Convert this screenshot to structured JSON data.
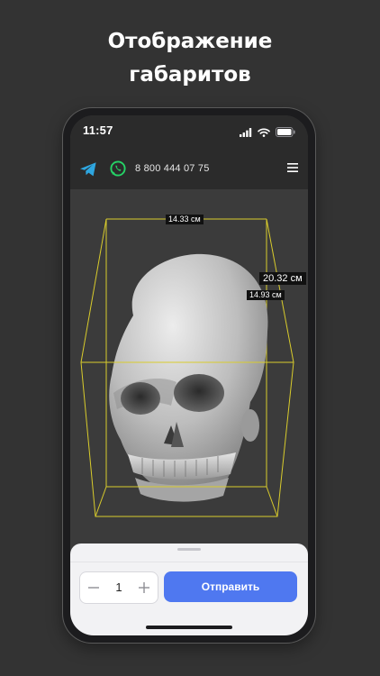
{
  "headline": {
    "line1": "Отображение",
    "line2": "габаритов"
  },
  "status": {
    "time": "11:57"
  },
  "appbar": {
    "telegram_icon": "telegram-icon",
    "whatsapp_icon": "whatsapp-icon",
    "phone": "8 800 444 07 75",
    "menu_icon": "hamburger-menu-icon"
  },
  "viewer": {
    "dim_x": "14.33 см",
    "dim_y": "20.32 см",
    "dim_z": "14.93 см",
    "bbox_color": "#d9cc2c"
  },
  "order": {
    "quantity": "1",
    "send_label": "Отправить",
    "accent": "#4f78f0"
  }
}
